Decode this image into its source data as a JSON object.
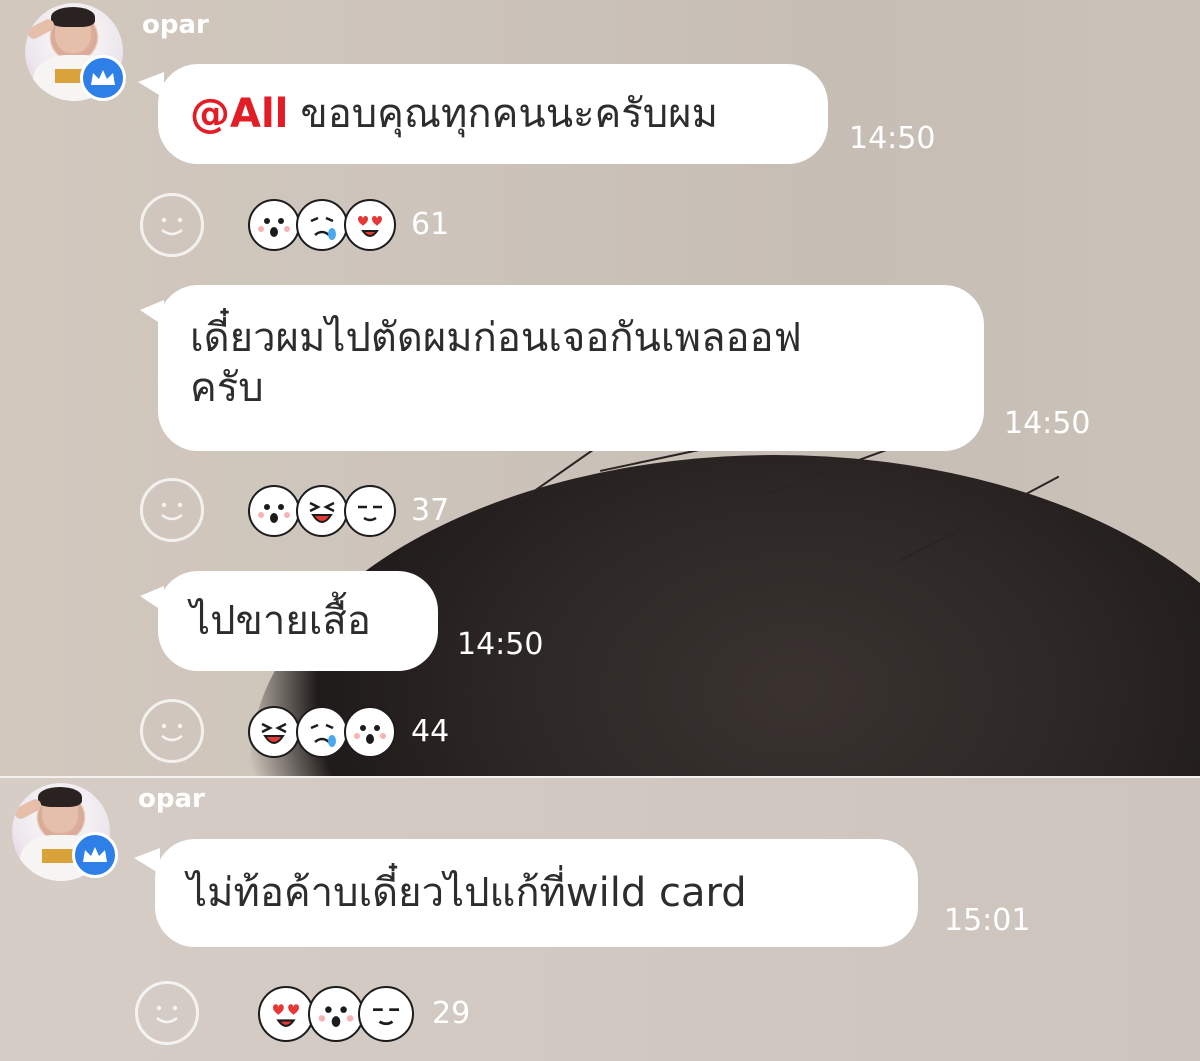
{
  "colors": {
    "bubble": "#ffffff",
    "mention": "#e21d25",
    "badge": "#2f7fe8",
    "overlay_text": "#ffffff"
  },
  "sections": [
    {
      "username": "opar",
      "badge_icon": "crown-icon",
      "messages": [
        {
          "mention": "@All",
          "text": "ขอบคุณทุกคนนะครับผม",
          "time": "14:50",
          "reactions": {
            "icons": [
              "shocked-face",
              "crying-face",
              "heart-eyes-face"
            ],
            "count": "61"
          }
        },
        {
          "text_lines": [
            "เดี๋ยวผมไปตัดผมก่อนเจอกันเพลออฟ",
            "ครับ"
          ],
          "time": "14:50",
          "reactions": {
            "icons": [
              "shocked-face",
              "laughing-face",
              "smug-face"
            ],
            "count": "37"
          }
        },
        {
          "text": "ไปขายเสื้อ",
          "time": "14:50",
          "reactions": {
            "icons": [
              "laughing-face",
              "crying-face",
              "shocked-face"
            ],
            "count": "44"
          }
        }
      ]
    },
    {
      "username": "opar",
      "badge_icon": "crown-icon",
      "messages": [
        {
          "text": "ไม่ท้อค้าบเดี๋ยวไปแก้ที่wild card",
          "time": "15:01",
          "reactions": {
            "icons": [
              "heart-eyes-face",
              "shocked-face",
              "smug-face"
            ],
            "count": "29"
          }
        }
      ]
    }
  ]
}
